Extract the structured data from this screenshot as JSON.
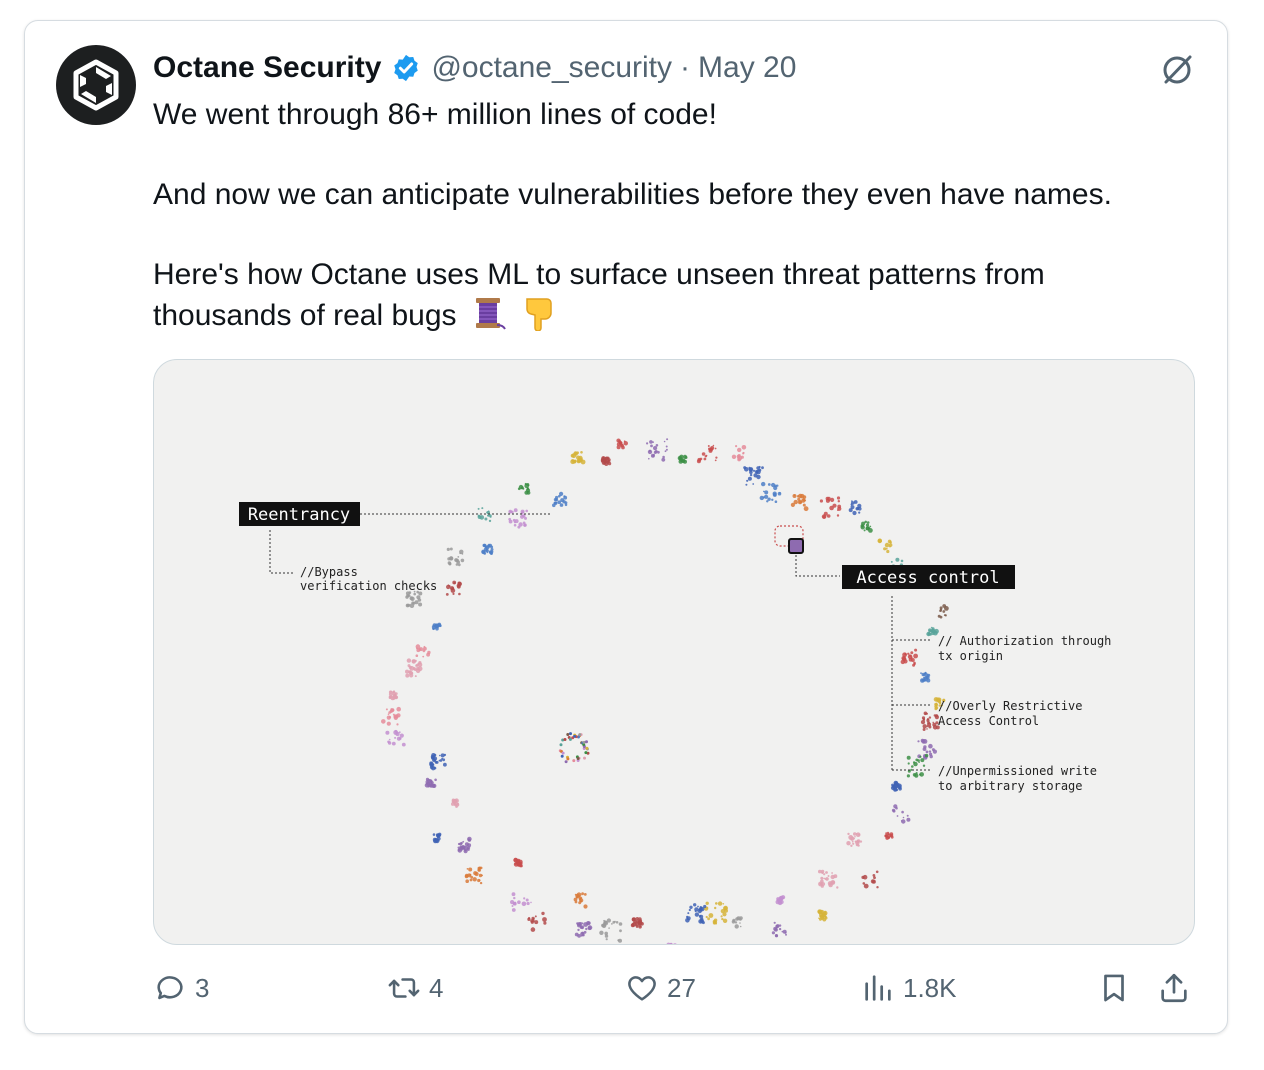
{
  "post": {
    "display_name": "Octane Security",
    "handle": "@octane_security",
    "separator": "·",
    "date": "May 20",
    "text_lines": [
      "We went through 86+ million lines of code!",
      "And now we can anticipate vulnerabilities before they even have names.",
      "Here's how Octane uses ML to surface unseen threat patterns from",
      "thousands of real bugs"
    ],
    "emojis": [
      "thread-spool",
      "backhand-index-pointing-down"
    ]
  },
  "media": {
    "labels": {
      "reentrancy": "Reentrancy",
      "reentrancy_note_1": "//Bypass",
      "reentrancy_note_2": "verification checks",
      "access_control": "Access control",
      "ac_note_1a": "// Authorization through",
      "ac_note_1b": "tx origin",
      "ac_note_2a": "//Overly Restrictive",
      "ac_note_2b": "Access Control",
      "ac_note_3a": "//Unpermissioned write",
      "ac_note_3b": "to arbitrary storage"
    },
    "cluster_colors": [
      "#8e6bb0",
      "#d6b43a",
      "#3f63b5",
      "#e58c9a",
      "#58a39a",
      "#d97a3a",
      "#3c8f45",
      "#9a9a9a",
      "#7a5a4a",
      "#b34a4a",
      "#c38fd0",
      "#e0a0b0",
      "#4d7fc7",
      "#c94e4e"
    ]
  },
  "actions": {
    "reply_count": "3",
    "repost_count": "4",
    "like_count": "27",
    "views_count": "1.8K"
  },
  "colors": {
    "verified": "#1d9bf0",
    "muted_text": "#536471",
    "label_bg": "#111111"
  }
}
